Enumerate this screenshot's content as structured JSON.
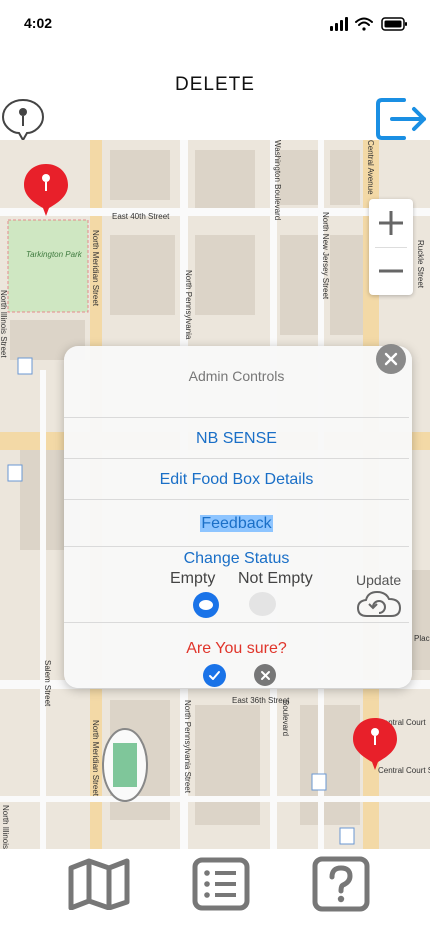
{
  "status_bar": {
    "time": "4:02",
    "icons": [
      "cellular-signal-icon",
      "wifi-icon",
      "battery-icon"
    ]
  },
  "header": {
    "title": "DELETE",
    "left_icon": "map-pin-icon",
    "right_icon": "logout-icon",
    "accent_color": "#1a8fe3"
  },
  "map": {
    "streets": [
      "East 40th Street",
      "North Meridian Street",
      "North Pennsylvania",
      "Washington Boulevard",
      "North New Jersey Street",
      "Central Avenue",
      "Ruckle Street",
      "North Illinois Street",
      "East 36th Street",
      "North Meridian Street",
      "North Pennsylvania Street",
      "Boulevard",
      "Salem Street",
      "Central Court South",
      "Central Court",
      "North Illinois"
    ],
    "parks": [
      "Tarkington Park"
    ],
    "place_fragments": [
      "Plac"
    ],
    "zoom": {
      "in_label": "+",
      "out_label": "−"
    },
    "marker_color": "#e8202a"
  },
  "admin_modal": {
    "title": "Admin Controls",
    "items": [
      "NB SENSE",
      "Edit Food Box Details",
      "Feedback"
    ],
    "change_status": {
      "title": "Change Status",
      "options": [
        "Empty",
        "Not Empty"
      ],
      "selected": "Empty"
    },
    "update_label": "Update",
    "confirm": {
      "question": "Are You sure?",
      "yes_icon": "check-icon",
      "no_icon": "close-icon"
    },
    "close_icon": "close-icon",
    "link_color": "#1a6fc7",
    "danger_color": "#e0352b"
  },
  "tab_bar": {
    "tabs": [
      "map-icon",
      "list-icon",
      "help-icon"
    ]
  }
}
